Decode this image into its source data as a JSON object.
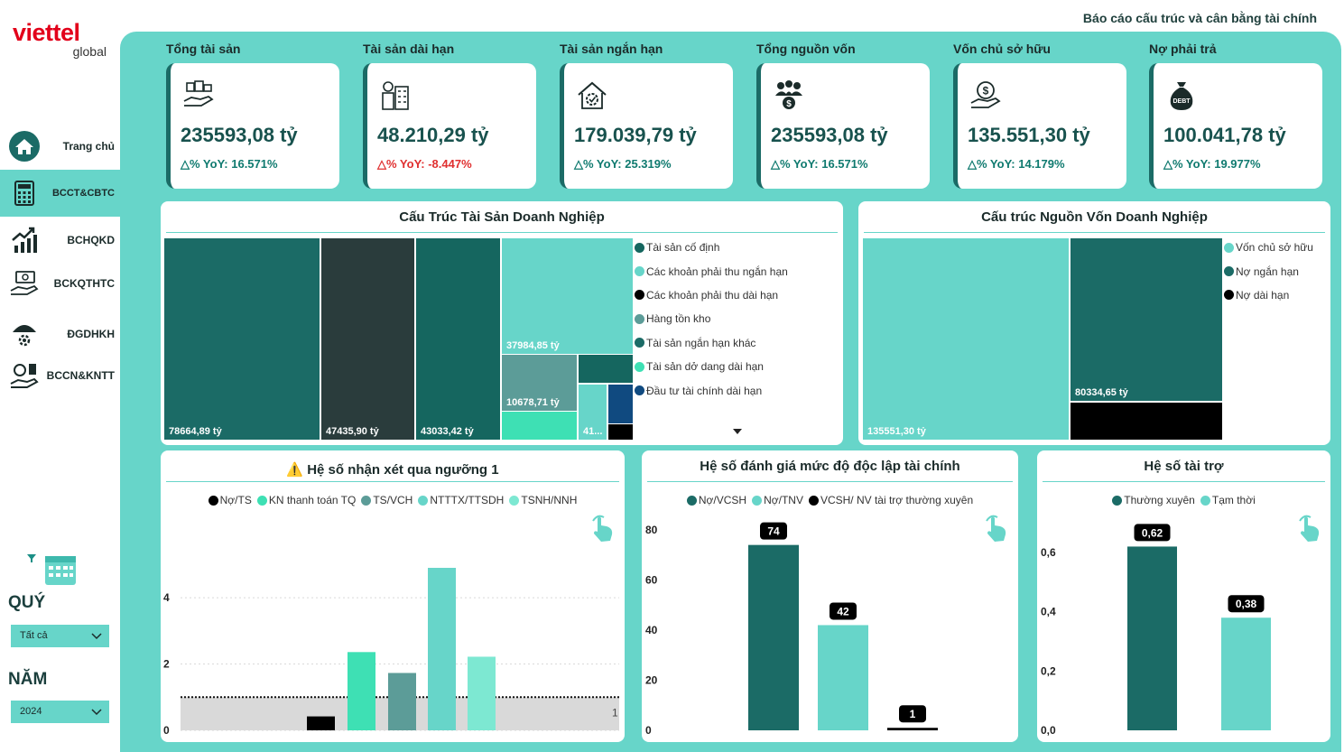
{
  "app": {
    "logo_text": "viettel",
    "logo_sub": "global",
    "report_title": "Báo cáo cấu trúc và cân bằng tài chính"
  },
  "nav": [
    {
      "label": "Trang chủ",
      "icon": "home-icon",
      "active": false
    },
    {
      "label": "BCCT&CBTC",
      "icon": "calculator-icon",
      "active": true
    },
    {
      "label": "BCHQKD",
      "icon": "growth-chart-icon",
      "active": false
    },
    {
      "label": "BCKQTHTC",
      "icon": "money-hand-icon",
      "active": false
    },
    {
      "label": "ĐGDHKH",
      "icon": "umbrella-gear-icon",
      "active": false
    },
    {
      "label": "BCCN&KNTT",
      "icon": "debt-hand-icon",
      "active": false
    }
  ],
  "filters": {
    "quarter_label": "QUÝ",
    "quarter_value": "Tất cả",
    "year_label": "NĂM",
    "year_value": "2024"
  },
  "kpis": [
    {
      "title": "Tổng tài sản",
      "value": "235593,08 tỷ",
      "yoy": "△% YoY: 16.571%",
      "negative": false,
      "icon": "assets-hand-icon"
    },
    {
      "title": "Tài sản dài hạn",
      "value": "48.210,29 tỷ",
      "yoy": "△% YoY: -8.447%",
      "negative": true,
      "icon": "buildings-icon"
    },
    {
      "title": "Tài sản ngắn hạn",
      "value": "179.039,79 tỷ",
      "yoy": "△% YoY: 25.319%",
      "negative": false,
      "icon": "house-gear-icon"
    },
    {
      "title": "Tổng nguồn vốn",
      "value": "235593,08 tỷ",
      "yoy": "△% YoY: 16.571%",
      "negative": false,
      "icon": "people-money-icon"
    },
    {
      "title": "Vốn chủ sở hữu",
      "value": "135.551,30 tỷ",
      "yoy": "△% YoY: 14.179%",
      "negative": false,
      "icon": "cash-hand-icon"
    },
    {
      "title": "Nợ phải trả",
      "value": "100.041,78 tỷ",
      "yoy": "△% YoY: 19.977%",
      "negative": false,
      "icon": "debt-bag-icon"
    }
  ],
  "colors": {
    "panel": "#67d5c9",
    "dark_teal": "#1b6b66",
    "darkest": "#2a3c3c",
    "deep_teal": "#15665f",
    "light_teal": "#67d5c9",
    "grey_teal": "#5c9c98",
    "mint": "#3ee0b4",
    "black": "#000000",
    "navy": "#104a80"
  },
  "asset_treemap": {
    "title": "Cấu Trúc Tài Sản Doanh Nghiệp",
    "legend": [
      {
        "label": "Tài sản cố định",
        "color": "#15665f"
      },
      {
        "label": "Các khoản phải thu ngắn hạn",
        "color": "#67d5c9"
      },
      {
        "label": "Các khoản phải thu dài hạn",
        "color": "#000000"
      },
      {
        "label": "Hàng tồn kho",
        "color": "#5c9c98"
      },
      {
        "label": "Tài sản ngắn hạn khác",
        "color": "#1b6b66"
      },
      {
        "label": "Tài sản dở dang dài hạn",
        "color": "#3ee0b4"
      },
      {
        "label": "Đầu tư tài chính dài hạn",
        "color": "#104a80"
      }
    ],
    "tiles": [
      {
        "label": "78664,89 tỷ"
      },
      {
        "label": "47435,90 tỷ"
      },
      {
        "label": "43033,42 tỷ"
      },
      {
        "label": "37984,85 tỷ"
      },
      {
        "label": "10678,71 tỷ"
      },
      {
        "label": "41..."
      }
    ]
  },
  "capital_treemap": {
    "title": "Cấu trúc Nguồn Vốn Doanh Nghiệp",
    "legend": [
      {
        "label": "Vốn chủ sở hữu",
        "color": "#67d5c9"
      },
      {
        "label": "Nợ ngắn hạn",
        "color": "#1b6b66"
      },
      {
        "label": "Nợ dài hạn",
        "color": "#000000"
      }
    ],
    "tiles": [
      {
        "label": "135551,30 tỷ"
      },
      {
        "label": "80334,65 tỷ"
      }
    ]
  },
  "chart_data": [
    {
      "type": "bar",
      "title": "⚠️ Hệ số nhận xét qua ngưỡng 1",
      "categories": [
        "Nợ/TS",
        "KN thanh toán TQ",
        "TS/VCH",
        "NTTTX/TTSDH",
        "TSNH/NNH"
      ],
      "values": [
        0.42,
        2.36,
        1.73,
        4.9,
        2.22
      ],
      "colors": [
        "#000000",
        "#3ee0b4",
        "#5c9c98",
        "#67d5c9",
        "#7de8d2"
      ],
      "legend": [
        "Nợ/TS",
        "KN thanh toán TQ",
        "TS/VCH",
        "NTTTX/TTSDH",
        "TSNH/NNH"
      ],
      "threshold": 1,
      "threshold_label": "1",
      "yticks": [
        0,
        2,
        4
      ],
      "ylim": [
        0,
        5.05
      ]
    },
    {
      "type": "bar",
      "title": "Hệ số đánh giá mức độ độc lập tài chính",
      "categories": [
        "Nợ/VCSH",
        "Nợ/TNV",
        "VCSH/ NV tài trợ thường xuyên"
      ],
      "values": [
        74,
        42,
        1
      ],
      "data_labels": [
        "74",
        "42",
        "1"
      ],
      "colors": [
        "#1b6b66",
        "#67d5c9",
        "#000000"
      ],
      "legend": [
        "Nợ/VCSH",
        "Nợ/TNV",
        "VCSH/ NV tài trợ thường xuyên"
      ],
      "yticks": [
        0,
        20,
        40,
        60,
        80
      ],
      "ylim": [
        0,
        80
      ]
    },
    {
      "type": "bar",
      "title": "Hệ số tài trợ",
      "categories": [
        "Thường xuyên",
        "Tạm thời"
      ],
      "values": [
        0.62,
        0.38
      ],
      "data_labels": [
        "0,62",
        "0,38"
      ],
      "colors": [
        "#1b6b66",
        "#67d5c9"
      ],
      "legend": [
        "Thường xuyên",
        "Tạm thời"
      ],
      "yticks": [
        "0,0",
        "0,2",
        "0,4",
        "0,6"
      ],
      "ylim": [
        0,
        0.6
      ]
    }
  ]
}
